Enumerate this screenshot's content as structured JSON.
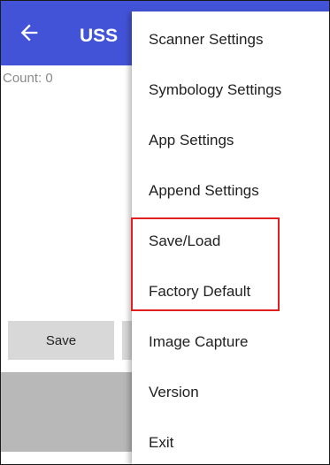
{
  "appbar": {
    "title": "USS",
    "back_icon": "arrow-left-icon",
    "background": "#4253d8"
  },
  "content": {
    "count_label": "Count: 0",
    "save_button_label": "Save"
  },
  "overflow_menu": {
    "items": [
      {
        "label": "Scanner Settings"
      },
      {
        "label": "Symbology Settings"
      },
      {
        "label": "App Settings"
      },
      {
        "label": "Append Settings"
      },
      {
        "label": "Save/Load"
      },
      {
        "label": "Factory Default"
      },
      {
        "label": "Image Capture"
      },
      {
        "label": "Version"
      },
      {
        "label": "Exit"
      }
    ]
  },
  "annotation": {
    "highlight_color": "#e02020",
    "highlighted_items": [
      "Save/Load",
      "Factory Default"
    ]
  }
}
